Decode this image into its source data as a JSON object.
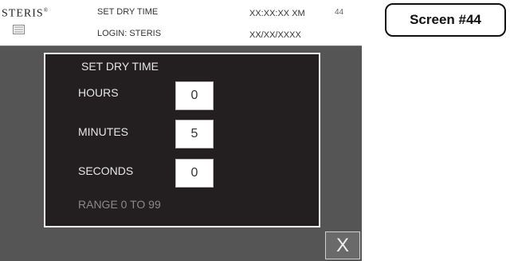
{
  "header": {
    "brand": "STERIS",
    "brand_mark": "®",
    "title": "SET DRY TIME",
    "login": "LOGIN: STERIS",
    "time": "XX:XX:XX XM",
    "date": "XX/XX/XXXX",
    "screen_number": "44"
  },
  "panel": {
    "title": "SET DRY TIME",
    "hours_label": "HOURS",
    "hours_value": "0",
    "minutes_label": "MINUTES",
    "minutes_value": "5",
    "seconds_label": "SECONDS",
    "seconds_value": "0",
    "range_text": "RANGE 0 TO 99"
  },
  "close_label": "X",
  "screen_badge": "Screen #44",
  "icons": {
    "logo": "steris-logo-icon"
  },
  "colors": {
    "panel_bg": "#231f20",
    "screen_bg": "#555555",
    "range_text": "#8a8a8a"
  }
}
